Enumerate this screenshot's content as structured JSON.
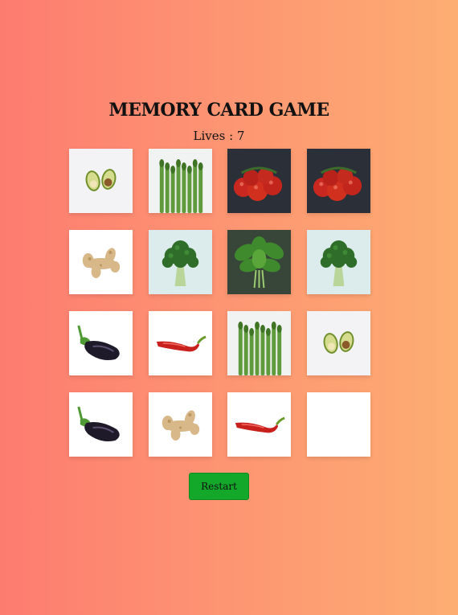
{
  "game": {
    "title": "MEMORY CARD GAME",
    "lives_text": "Lives : 7",
    "restart_label": "Restart"
  },
  "cards": [
    {
      "row": 0,
      "col": 0,
      "image": "avocado-icon",
      "state": "revealed"
    },
    {
      "row": 0,
      "col": 1,
      "image": "asparagus-icon",
      "state": "revealed"
    },
    {
      "row": 0,
      "col": 2,
      "image": "tomatoes-icon",
      "state": "revealed"
    },
    {
      "row": 0,
      "col": 3,
      "image": "tomatoes-icon",
      "state": "revealed"
    },
    {
      "row": 1,
      "col": 0,
      "image": "ginger-icon",
      "state": "revealed"
    },
    {
      "row": 1,
      "col": 1,
      "image": "broccoli-icon",
      "state": "revealed"
    },
    {
      "row": 1,
      "col": 2,
      "image": "spinach-icon",
      "state": "revealed"
    },
    {
      "row": 1,
      "col": 3,
      "image": "broccoli-icon",
      "state": "revealed"
    },
    {
      "row": 2,
      "col": 0,
      "image": "eggplant-icon",
      "state": "revealed"
    },
    {
      "row": 2,
      "col": 1,
      "image": "chili-pepper-icon",
      "state": "revealed"
    },
    {
      "row": 2,
      "col": 2,
      "image": "asparagus-icon",
      "state": "revealed"
    },
    {
      "row": 2,
      "col": 3,
      "image": "avocado-icon",
      "state": "revealed"
    },
    {
      "row": 3,
      "col": 0,
      "image": "eggplant-icon",
      "state": "revealed"
    },
    {
      "row": 3,
      "col": 1,
      "image": "ginger-icon",
      "state": "revealed"
    },
    {
      "row": 3,
      "col": 2,
      "image": "chili-pepper-icon",
      "state": "revealed"
    },
    {
      "row": 3,
      "col": 3,
      "image": "blank-icon",
      "state": "hidden"
    }
  ],
  "colors": {
    "background_start": "#fd7c70",
    "background_end": "#fdad72",
    "restart_button": "#14a82a"
  }
}
